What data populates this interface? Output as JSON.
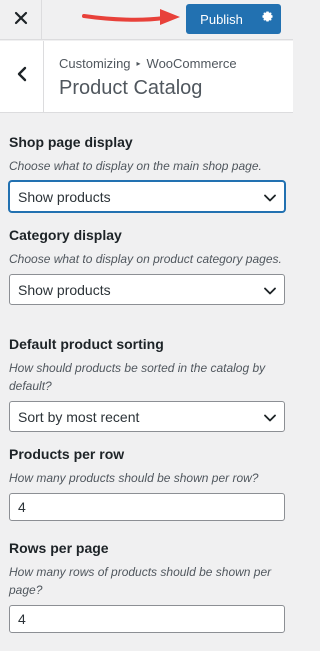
{
  "toolbar": {
    "publish_label": "Publish",
    "accent": "#2271b1",
    "arrow_color": "#e8413a"
  },
  "header": {
    "breadcrumb_parent": "Customizing",
    "breadcrumb_child": "WooCommerce",
    "title": "Product Catalog"
  },
  "fields": {
    "shop_display": {
      "label": "Shop page display",
      "description": "Choose what to display on the main shop page.",
      "value": "Show products"
    },
    "category_display": {
      "label": "Category display",
      "description": "Choose what to display on product category pages.",
      "value": "Show products"
    },
    "sorting": {
      "label": "Default product sorting",
      "description": "How should products be sorted in the catalog by default?",
      "value": "Sort by most recent"
    },
    "per_row": {
      "label": "Products per row",
      "description": "How many products should be shown per row?",
      "value": "4"
    },
    "rows_per_page": {
      "label": "Rows per page",
      "description": "How many rows of products should be shown per page?",
      "value": "4"
    }
  },
  "icons": {
    "close": "close-icon",
    "settings": "gear-icon",
    "back": "chevron-left-icon",
    "select": "chevron-down-icon",
    "annotation": "arrow-annotation"
  }
}
